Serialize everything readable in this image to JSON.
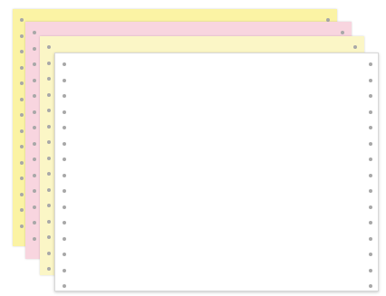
{
  "image": {
    "subject": "continuous-feed-paper",
    "sheets": [
      {
        "name": "yellow-sheet",
        "color": "#fbf3a4"
      },
      {
        "name": "pink-sheet",
        "color": "#f8d5df"
      },
      {
        "name": "cream-sheet",
        "color": "#fbf6c6"
      },
      {
        "name": "white-sheet",
        "color": "#ffffff"
      }
    ],
    "hole_color": "#a8a8a8",
    "background": "#ffffff"
  }
}
